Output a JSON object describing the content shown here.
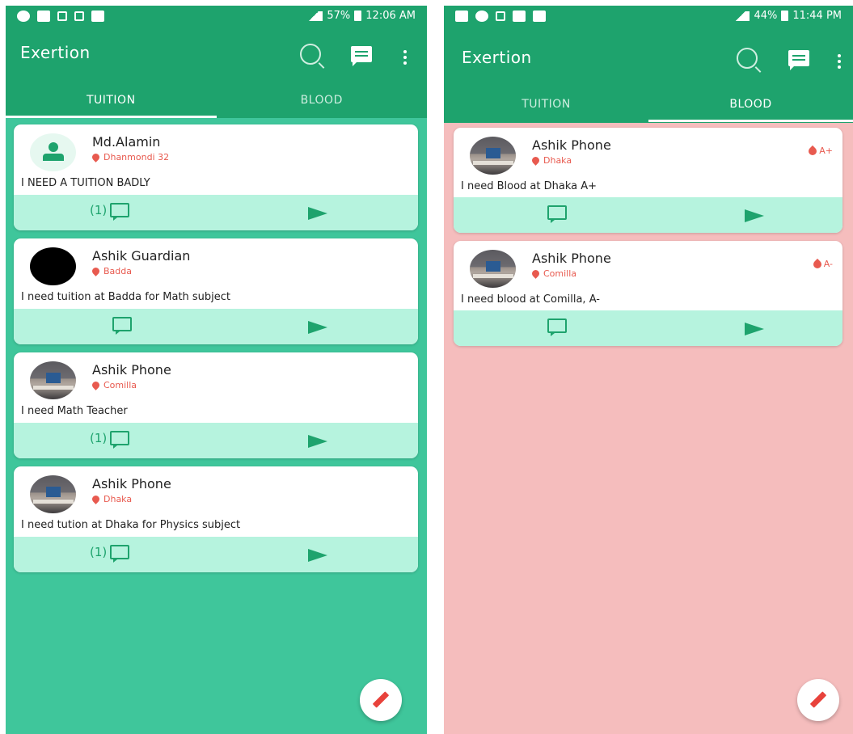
{
  "screens": [
    {
      "status": {
        "battery_percent": "57%",
        "time": "12:06 AM"
      },
      "app_title": "Exertion",
      "tabs": [
        {
          "label": "TUITION",
          "active": true
        },
        {
          "label": "BLOOD",
          "active": false
        }
      ],
      "posts": [
        {
          "name": "Md.Alamin",
          "location": "Dhanmondi 32",
          "message": "I NEED A TUITION BADLY",
          "comment_count": "(1)",
          "avatar": "default-person-icon"
        },
        {
          "name": "Ashik Guardian",
          "location": "Badda",
          "message": "I need tuition at Badda for Math subject",
          "comment_count": "",
          "avatar": "black-photo"
        },
        {
          "name": "Ashik Phone",
          "location": "Comilla",
          "message": "I need Math Teacher",
          "comment_count": "(1)",
          "avatar": "desk-photo"
        },
        {
          "name": "Ashik Phone",
          "location": "Dhaka",
          "message": "I need tution at Dhaka for Physics subject",
          "comment_count": "(1)",
          "avatar": "desk-photo"
        }
      ]
    },
    {
      "status": {
        "battery_percent": "44%",
        "time": "11:44 PM"
      },
      "app_title": "Exertion",
      "tabs": [
        {
          "label": "TUITION",
          "active": false
        },
        {
          "label": "BLOOD",
          "active": true
        }
      ],
      "posts": [
        {
          "name": "Ashik Phone",
          "location": "Dhaka",
          "message": "I need Blood at Dhaka A+",
          "blood_group": "A+",
          "avatar": "desk-photo"
        },
        {
          "name": "Ashik Phone",
          "location": "Comilla",
          "message": "I need blood at Comilla, A-",
          "blood_group": "A-",
          "avatar": "desk-photo"
        }
      ]
    }
  ],
  "colors": {
    "primary": "#1ea36d",
    "tuition_bg": "#3fc69b",
    "blood_bg": "#f5bdbd",
    "card_footer": "#b6f3de",
    "accent_red": "#e85a4f"
  }
}
